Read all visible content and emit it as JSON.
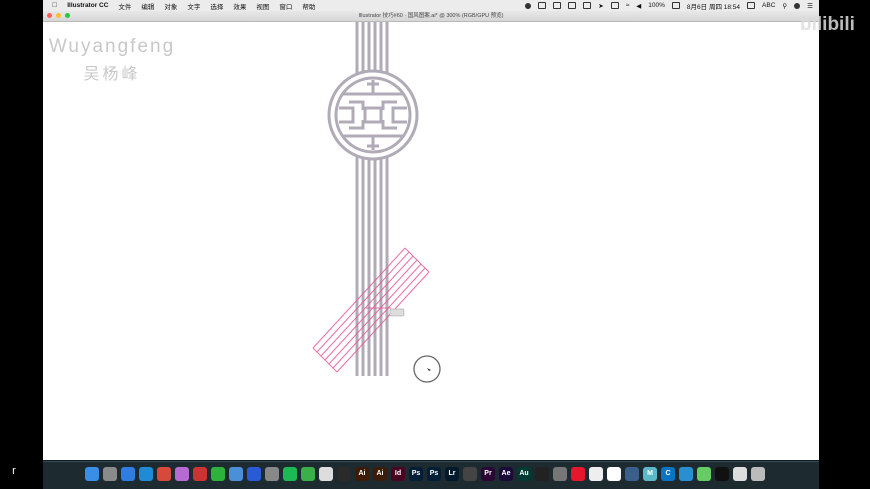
{
  "menubar": {
    "app_name": "Illustrator CC",
    "menus": [
      "文件",
      "编辑",
      "对象",
      "文字",
      "选择",
      "效果",
      "视图",
      "窗口",
      "帮助"
    ],
    "battery": "100%",
    "clock": "8月6日 周四  18:54",
    "input_method": "ABC"
  },
  "window": {
    "title": "Illustrator 技巧#60 · 国风图案.ai* @ 300% (RGB/GPU 预览)"
  },
  "watermark": {
    "name_en": "Wuyangfeng",
    "name_cn": "吴杨峰"
  },
  "overlay": {
    "logo": "bilibili",
    "key_hint": "r"
  },
  "colors": {
    "artwork_stroke": "#b0abb7",
    "selection": "#e6559a",
    "canvas": "#ffffff",
    "dock_bg": "#1d2b30"
  },
  "dock": {
    "apps": [
      {
        "icon": "finder-icon",
        "label": "",
        "color": "#3a8ee6"
      },
      {
        "icon": "launchpad-icon",
        "label": "",
        "color": "#8a8a8a"
      },
      {
        "icon": "appstore-icon",
        "label": "",
        "color": "#2f7de1"
      },
      {
        "icon": "safari-icon",
        "label": "",
        "color": "#1f8ad6"
      },
      {
        "icon": "chrome-icon",
        "label": "",
        "color": "#d7493b"
      },
      {
        "icon": "photos-icon",
        "label": "",
        "color": "#b56bd1"
      },
      {
        "icon": "game-icon",
        "label": "",
        "color": "#c33"
      },
      {
        "icon": "wechat-icon",
        "label": "",
        "color": "#2db33b"
      },
      {
        "icon": "xcode-icon",
        "label": "",
        "color": "#4a90d9"
      },
      {
        "icon": "baidu-icon",
        "label": "",
        "color": "#2a5bd7"
      },
      {
        "icon": "quicktime-icon",
        "label": "",
        "color": "#888"
      },
      {
        "icon": "spotify-icon",
        "label": "",
        "color": "#1db954"
      },
      {
        "icon": "maps-icon",
        "label": "",
        "color": "#3bb04a"
      },
      {
        "icon": "font-icon",
        "label": "",
        "color": "#ddd"
      },
      {
        "icon": "terminal-icon",
        "label": "",
        "color": "#2a2a2a"
      },
      {
        "icon": "illustrator-icon",
        "label": "Ai",
        "color": "#3b1d07"
      },
      {
        "icon": "illustrator-icon",
        "label": "Ai",
        "color": "#3b1d07"
      },
      {
        "icon": "indesign-icon",
        "label": "Id",
        "color": "#49021f"
      },
      {
        "icon": "photoshop-icon",
        "label": "Ps",
        "color": "#001e36"
      },
      {
        "icon": "photoshop-icon",
        "label": "Ps",
        "color": "#001e36"
      },
      {
        "icon": "lightroom-icon",
        "label": "Lr",
        "color": "#001a2c"
      },
      {
        "icon": "clapper-icon",
        "label": "",
        "color": "#444"
      },
      {
        "icon": "premiere-icon",
        "label": "Pr",
        "color": "#2a0634"
      },
      {
        "icon": "aftereffects-icon",
        "label": "Ae",
        "color": "#1a0a3a"
      },
      {
        "icon": "audition-icon",
        "label": "Au",
        "color": "#003a34"
      },
      {
        "icon": "record-icon",
        "label": "",
        "color": "#222"
      },
      {
        "icon": "settings-icon",
        "label": "",
        "color": "#777"
      },
      {
        "icon": "weibo-icon",
        "label": "",
        "color": "#e6162d"
      },
      {
        "icon": "bird-icon",
        "label": "",
        "color": "#eee"
      },
      {
        "icon": "text-icon",
        "label": "",
        "color": "#fff"
      },
      {
        "icon": "cyberduck-icon",
        "label": "",
        "color": "#3a5f8a"
      },
      {
        "icon": "mweb-icon",
        "label": "M",
        "color": "#5cb8c8"
      },
      {
        "icon": "cloud-icon",
        "label": "C",
        "color": "#0a74c4"
      },
      {
        "icon": "sync-icon",
        "label": "",
        "color": "#2a8fd0"
      },
      {
        "icon": "feather-icon",
        "label": "",
        "color": "#6c6"
      },
      {
        "icon": "screen-icon",
        "label": "",
        "color": "#111"
      },
      {
        "icon": "preview-icon",
        "label": "",
        "color": "#ddd"
      },
      {
        "icon": "trash-icon",
        "label": "",
        "color": "#bbb"
      }
    ]
  }
}
